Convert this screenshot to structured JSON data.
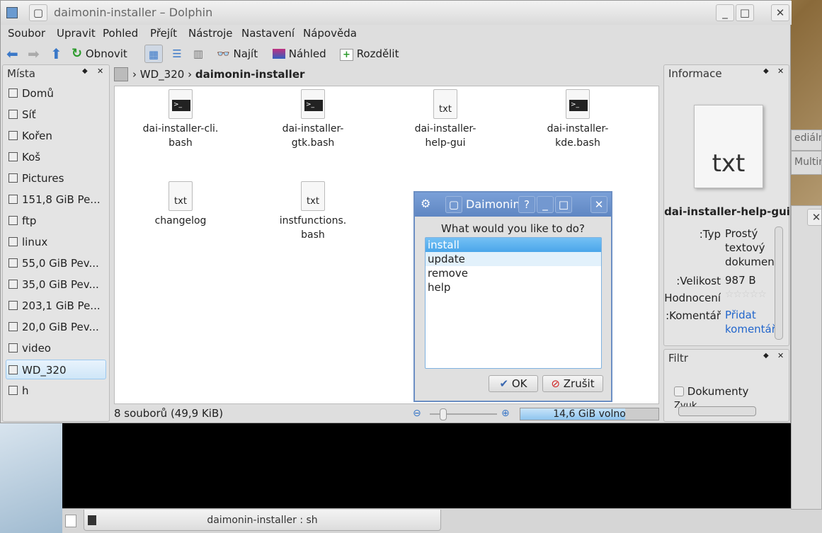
{
  "window": {
    "title": "daimonin-installer – Dolphin"
  },
  "menu": [
    "Soubor",
    "Upravit",
    "Pohled",
    "Přejít",
    "Nástroje",
    "Nastavení",
    "Nápověda"
  ],
  "toolbar": {
    "reload": "Obnovit",
    "find": "Najít",
    "preview": "Náhled",
    "split": "Rozdělit"
  },
  "places": {
    "title": "Místa",
    "items": [
      "Domů",
      "Síť",
      "Kořen",
      "Koš",
      "Pictures",
      "151,8 GiB Pe...",
      "ftp",
      "linux",
      "55,0 GiB Pev...",
      "35,0 GiB Pev...",
      "203,1 GiB Pe...",
      "20,0 GiB Pev...",
      "video",
      "WD_320",
      "h"
    ],
    "selected": "WD_320"
  },
  "breadcrumb": [
    "WD_320",
    "daimonin-installer"
  ],
  "files": [
    {
      "name": "dai-installer-cli.\nbash",
      "icon": "terminal"
    },
    {
      "name": "dai-installer-\ngtk.bash",
      "icon": "terminal"
    },
    {
      "name": "dai-installer-\nhelp-gui",
      "icon": "txt"
    },
    {
      "name": "dai-installer-\nkde.bash",
      "icon": "terminal"
    },
    {
      "name": "changelog",
      "icon": "txt"
    },
    {
      "name": "instfunctions.\nbash",
      "icon": "txt"
    }
  ],
  "status": {
    "summary": "8 souborů (49,9 KiB)",
    "free": "14,6 GiB volno",
    "free_fraction": 0.76
  },
  "info": {
    "title": "Informace",
    "icon_label": "txt",
    "filename": "dai-installer-help-gui",
    "type_label": "Typ:",
    "type_value": "Prostý textový dokumen",
    "size_label": "Velikost:",
    "size_value": "987 B",
    "rating_label": "Hodnocení:",
    "rating": 0,
    "comment_label": "Komentář:",
    "comment_link": "Přidat komentář"
  },
  "filter": {
    "title": "Filtr",
    "items": [
      "Dokumenty",
      "Zvuk"
    ]
  },
  "dialog": {
    "title": "Daimonin",
    "prompt": "What would you like to do?",
    "options": [
      "install",
      "update",
      "remove",
      "help"
    ],
    "selected": "install",
    "ok": "OK",
    "cancel": "Zrušit"
  },
  "konsole": {
    "tab": "daimonin-installer : sh"
  },
  "background_windows": [
    "ediální",
    "Multim"
  ]
}
